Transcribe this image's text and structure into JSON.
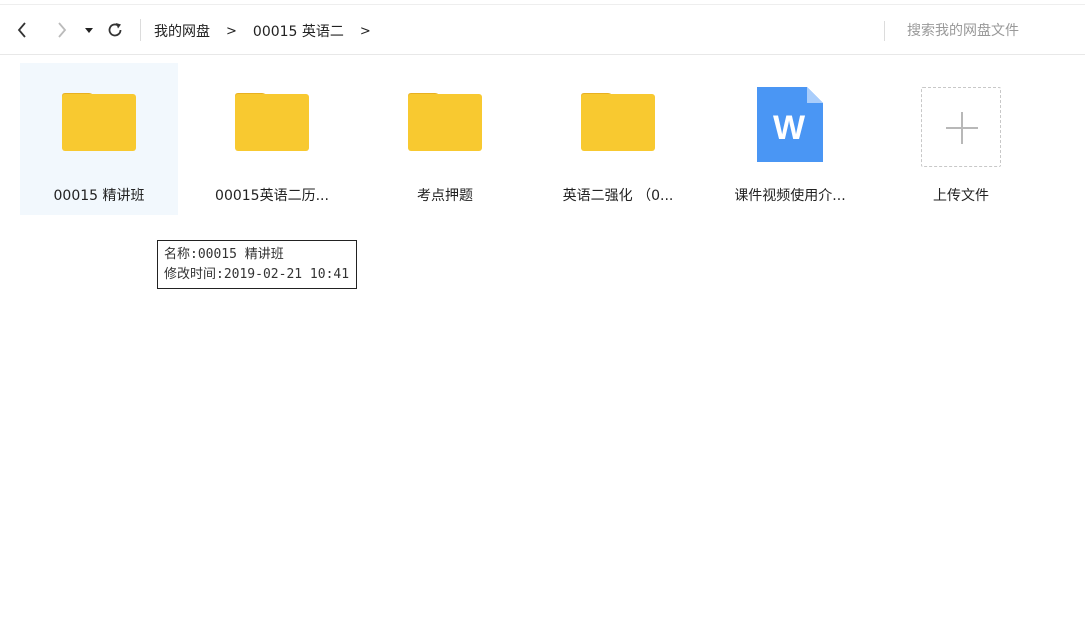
{
  "toolbar": {
    "back_icon": "chevron-left-icon",
    "forward_icon": "chevron-right-icon",
    "history_icon": "caret-down-icon",
    "refresh_icon": "refresh-icon",
    "breadcrumb": [
      "我的网盘",
      "00015 英语二"
    ],
    "breadcrumb_separator": ">",
    "search_placeholder": "搜索我的网盘文件"
  },
  "items": [
    {
      "label": "00015 精讲班",
      "type": "folder",
      "selected": true
    },
    {
      "label": "00015英语二历...",
      "type": "folder"
    },
    {
      "label": "考点押题",
      "type": "folder"
    },
    {
      "label": "英语二强化 （0...",
      "type": "folder"
    },
    {
      "label": "课件视频使用介...",
      "type": "word-doc",
      "badge": "W"
    },
    {
      "label": "上传文件",
      "type": "upload"
    }
  ],
  "tooltip": {
    "name_line": "名称:00015 精讲班",
    "time_line": "修改时间:2019-02-21 10:41"
  },
  "colors": {
    "folder": "#f8c930",
    "folder_tab": "#e8b021",
    "word": "#4a96f4",
    "word_fold": "#a9cdfb",
    "selected_bg": "#f2f8fd"
  }
}
